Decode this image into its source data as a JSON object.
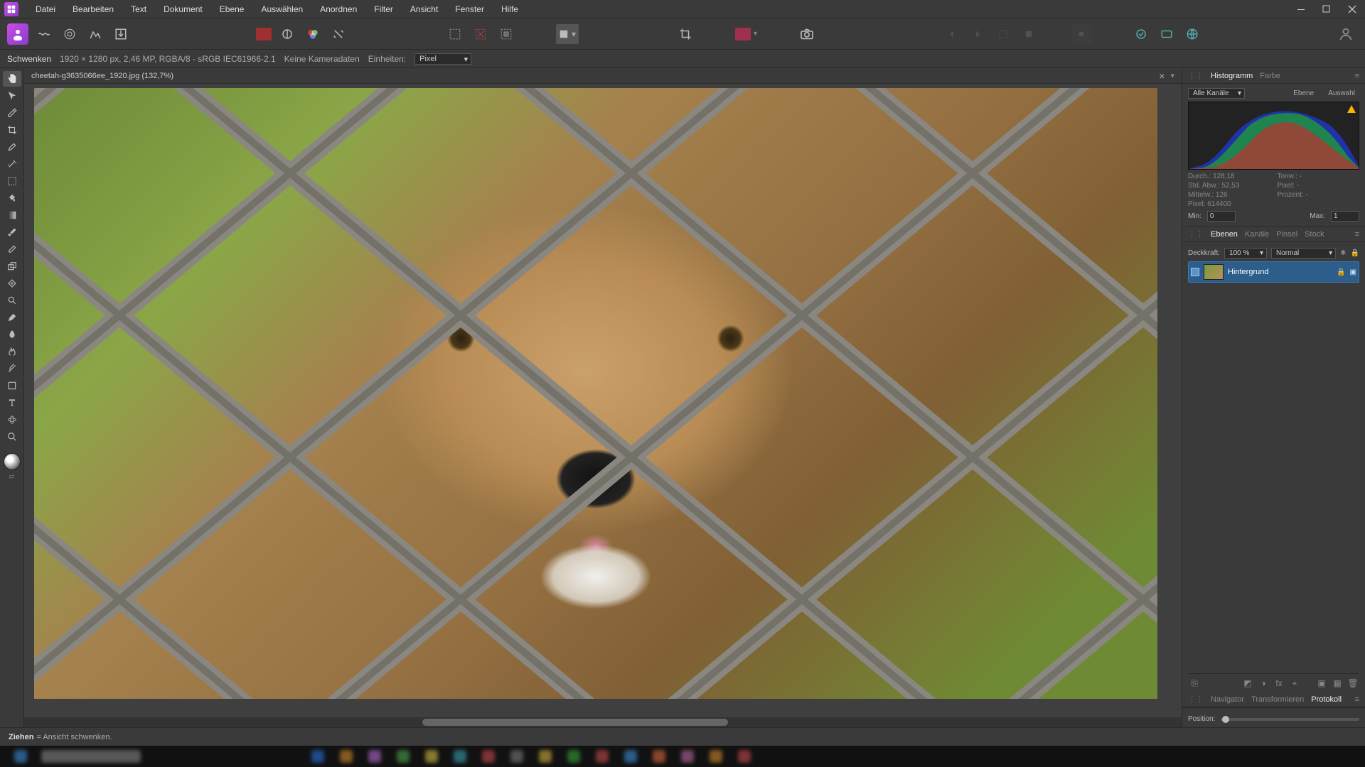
{
  "menu": [
    "Datei",
    "Bearbeiten",
    "Text",
    "Dokument",
    "Ebene",
    "Auswählen",
    "Anordnen",
    "Filter",
    "Ansicht",
    "Fenster",
    "Hilfe"
  ],
  "context": {
    "tool_name": "Schwenken",
    "doc_info": "1920 × 1280 px, 2,46 MP, RGBA/8 - sRGB IEC61966-2.1",
    "camera": "Keine Kameradaten",
    "units_label": "Einheiten:",
    "units_value": "Pixel"
  },
  "document": {
    "tab_title": "cheetah-g3635066ee_1920.jpg (132,7%)"
  },
  "panels": {
    "histogram": {
      "tabs": {
        "histogram": "Histogramm",
        "color": "Farbe"
      },
      "channel_select": "Alle Kanäle",
      "btn_layer": "Ebene",
      "btn_selection": "Auswahl",
      "stats": {
        "mean_label": "Durch.:",
        "mean_val": "128,18",
        "stddev_label": "Std. Abw.:",
        "stddev_val": "52,53",
        "median_label": "Mittelw.:",
        "median_val": "126",
        "pixels_label": "Pixel:",
        "pixels_val": "614400",
        "tone_label": "Tonw.:",
        "tone_val": "-",
        "pix_label": "Pixel:",
        "pix_val": "-",
        "percent_label": "Prozent:",
        "percent_val": "-"
      },
      "min_label": "Min:",
      "min_val": "0",
      "max_label": "Max:",
      "max_val": "1"
    },
    "layers": {
      "tabs": {
        "layers": "Ebenen",
        "channels": "Kanäle",
        "brushes": "Pinsel",
        "stock": "Stock"
      },
      "opacity_label": "Deckkraft:",
      "opacity_val": "100 %",
      "blend": "Normal",
      "layer_name": "Hintergrund"
    },
    "nav": {
      "tabs": {
        "navigator": "Navigator",
        "transform": "Transformieren",
        "history": "Protokoll"
      },
      "position_label": "Position:"
    }
  },
  "status": {
    "action": "Ziehen",
    "desc": " = Ansicht schwenken."
  },
  "taskbar_colors": [
    "#2a6fd6",
    "#d08b2a",
    "#b569d3",
    "#4aa34a",
    "#d6bb44",
    "#3aa0b0",
    "#c44a4a",
    "#7a7a7a",
    "#d3b040",
    "#3aa03a",
    "#c44a4a",
    "#3a8ed6",
    "#d66a3a",
    "#b56aa0",
    "#d08b2a",
    "#c44a4a"
  ]
}
